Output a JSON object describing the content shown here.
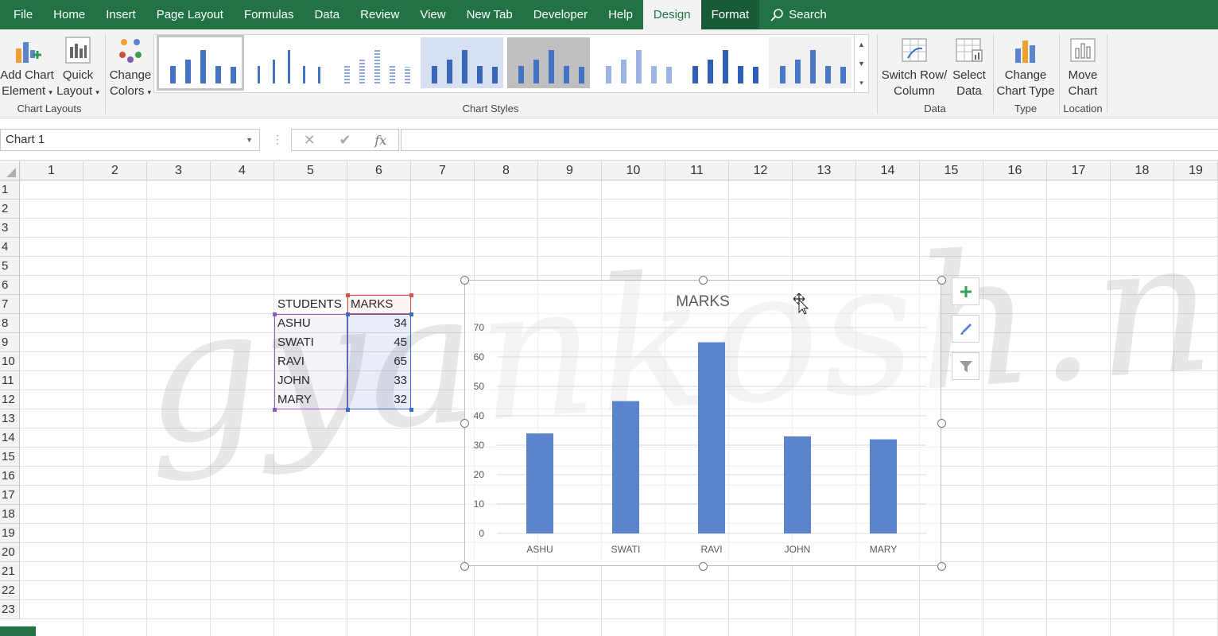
{
  "tabs": [
    "File",
    "Home",
    "Insert",
    "Page Layout",
    "Formulas",
    "Data",
    "Review",
    "View",
    "New Tab",
    "Developer",
    "Help",
    "Design",
    "Format"
  ],
  "active_tab": "Design",
  "search_label": "Search",
  "ribbon": {
    "add_chart_element": [
      "Add Chart",
      "Element"
    ],
    "quick_layout": [
      "Quick",
      "Layout"
    ],
    "change_colors": [
      "Change",
      "Colors"
    ],
    "switch_row_column": [
      "Switch Row/",
      "Column"
    ],
    "select_data": [
      "Select",
      "Data"
    ],
    "change_chart_type": [
      "Change",
      "Chart Type"
    ],
    "move_chart": [
      "Move",
      "Chart"
    ],
    "groups": {
      "chart_layouts": "Chart Layouts",
      "chart_styles": "Chart Styles",
      "data": "Data",
      "type": "Type",
      "location": "Location"
    }
  },
  "formula_bar": {
    "name_box": "Chart 1",
    "formula": ""
  },
  "columns": [
    "1",
    "2",
    "3",
    "4",
    "5",
    "6",
    "7",
    "8",
    "9",
    "10",
    "11",
    "12",
    "13",
    "14",
    "15",
    "16",
    "17",
    "18",
    "19"
  ],
  "rows": [
    "1",
    "2",
    "3",
    "4",
    "5",
    "6",
    "7",
    "8",
    "9",
    "10",
    "11",
    "12",
    "13",
    "14",
    "15",
    "16",
    "17",
    "18",
    "19",
    "20",
    "21",
    "22",
    "23"
  ],
  "table": {
    "headers": [
      "STUDENTS",
      "MARKS"
    ],
    "rows": [
      [
        "ASHU",
        "34"
      ],
      [
        "SWATI",
        "45"
      ],
      [
        "RAVI",
        "65"
      ],
      [
        "JOHN",
        "33"
      ],
      [
        "MARY",
        "32"
      ]
    ]
  },
  "watermark": "gyankosh.net",
  "chart_data": {
    "type": "bar",
    "title": "MARKS",
    "categories": [
      "ASHU",
      "SWATI",
      "RAVI",
      "JOHN",
      "MARY"
    ],
    "values": [
      34,
      45,
      65,
      33,
      32
    ],
    "ylim": [
      0,
      70
    ],
    "yticks": [
      "0",
      "10",
      "20",
      "30",
      "40",
      "50",
      "60",
      "70"
    ],
    "grid": true,
    "bar_color": "#5b84cc"
  },
  "colors": {
    "excel_green": "#217346",
    "bar_blue": "#5b84cc"
  }
}
